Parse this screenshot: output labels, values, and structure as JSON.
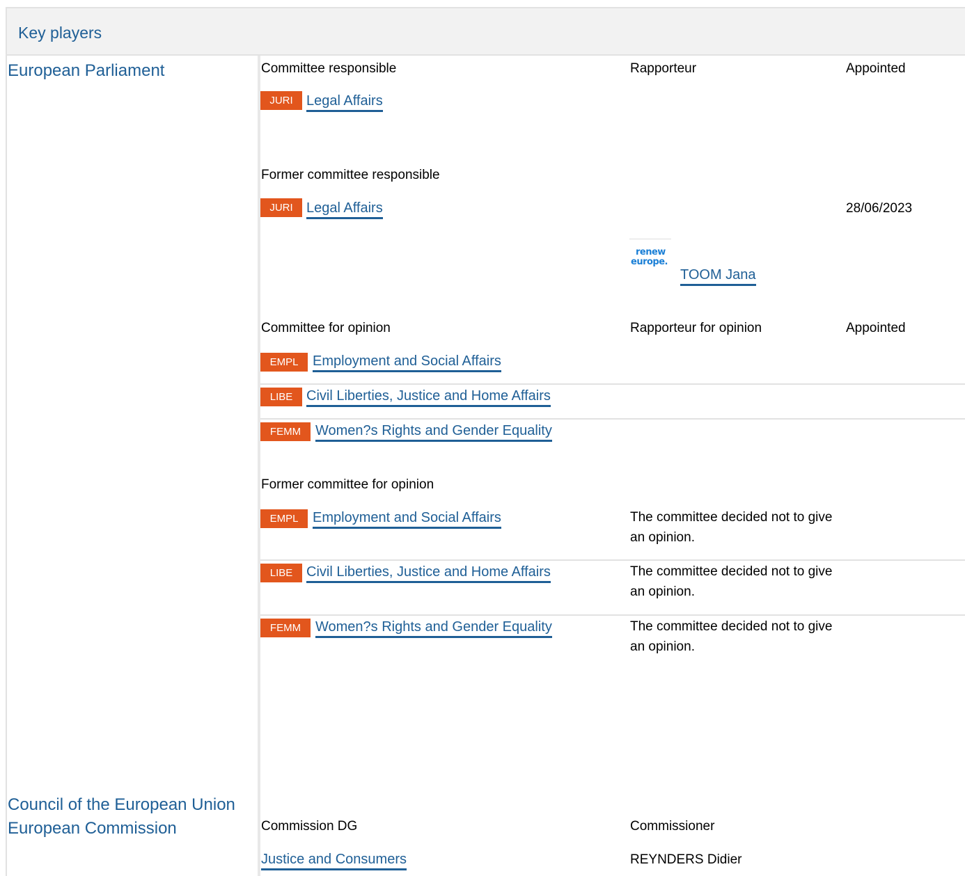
{
  "section_title": "Key players",
  "institutions": {
    "parliament": "European Parliament",
    "council": "Council of the European Union",
    "commission": "European Commission"
  },
  "headers": {
    "committee_responsible": "Committee responsible",
    "rapporteur": "Rapporteur",
    "appointed": "Appointed",
    "former_committee_responsible": "Former committee responsible",
    "committee_for_opinion": "Committee for opinion",
    "rapporteur_for_opinion": "Rapporteur for opinion",
    "former_committee_for_opinion": "Former committee for opinion",
    "commission_dg": "Commission DG",
    "commissioner": "Commissioner"
  },
  "committee_responsible": {
    "code": "JURI",
    "name": "Legal Affairs"
  },
  "former_committee_responsible": {
    "code": "JURI",
    "name": "Legal Affairs",
    "appointed": "28/06/2023",
    "rapporteur": "TOOM Jana",
    "group_logo": [
      "renew",
      "europe."
    ]
  },
  "committees_for_opinion": [
    {
      "code": "EMPL",
      "name": "Employment and Social Affairs"
    },
    {
      "code": "LIBE",
      "name": "Civil Liberties, Justice and Home Affairs"
    },
    {
      "code": "FEMM",
      "name": "Women?s Rights and Gender Equality"
    }
  ],
  "former_committees_for_opinion": [
    {
      "code": "EMPL",
      "name": "Employment and Social Affairs",
      "note": "The committee decided not to give an opinion."
    },
    {
      "code": "LIBE",
      "name": "Civil Liberties, Justice and Home Affairs",
      "note": "The committee decided not to give an opinion."
    },
    {
      "code": "FEMM",
      "name": "Women?s Rights and Gender Equality",
      "note": "The committee decided not to give an opinion."
    }
  ],
  "commission": {
    "dg": "Justice and Consumers",
    "commissioner": "REYNDERS Didier"
  },
  "colors": {
    "link": "#1f5f96",
    "badge": "#e2561d",
    "header_bg": "#f2f2f2",
    "border": "#e2e2e2"
  }
}
